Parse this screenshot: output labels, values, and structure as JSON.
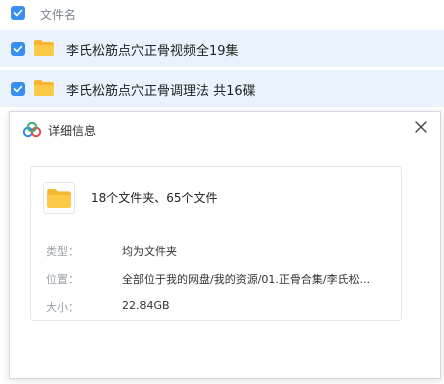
{
  "list": {
    "header_label": "文件名",
    "rows": [
      {
        "name": "李氏松筋点穴正骨视频全19集"
      },
      {
        "name": "李氏松筋点穴正骨调理法 共16碟"
      }
    ]
  },
  "dialog": {
    "title": "详细信息",
    "summary": "18个文件夹、65个文件",
    "type_label": "类型：",
    "type_value": "均为文件夹",
    "location_label": "位置：",
    "location_value": "全部位于我的网盘/我的资源/01.正骨合集/李氏松...",
    "size_label": "大小：",
    "size_value": "22.84GB"
  },
  "colors": {
    "accent": "#3a8ef0",
    "folder": "#fcc946",
    "selected_row": "#eaf3fd"
  },
  "icons": {
    "checkbox": "checkbox-checked-icon",
    "folder": "folder-icon",
    "logo": "cloud-logo-icon",
    "close": "close-icon"
  }
}
